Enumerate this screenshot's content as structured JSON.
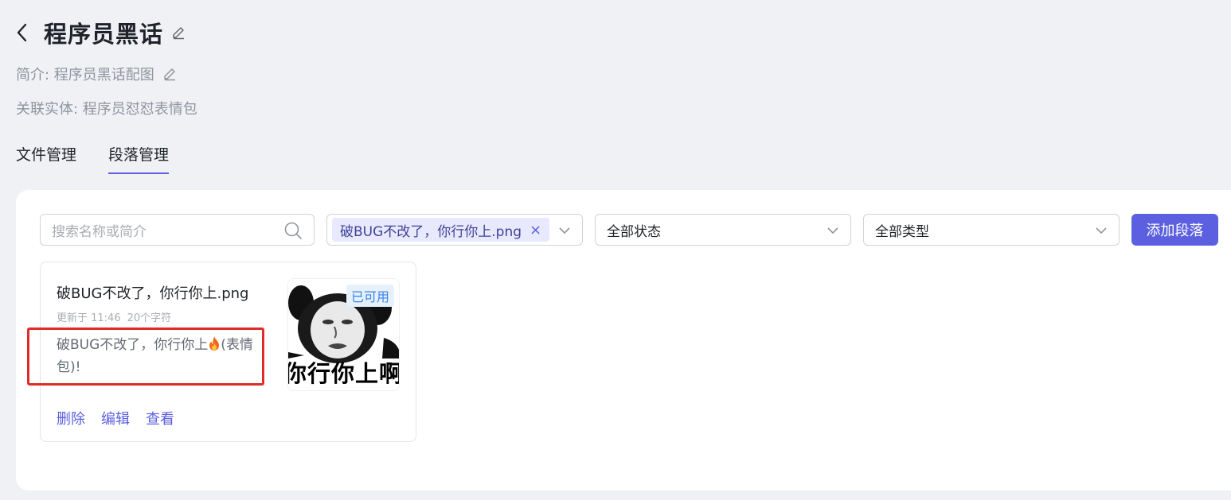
{
  "header": {
    "title": "程序员黑话",
    "intro": "简介: 程序员黑话配图",
    "entity": "关联实体: 程序员怼怼表情包"
  },
  "tabs": [
    {
      "label": "文件管理",
      "active": false
    },
    {
      "label": "段落管理",
      "active": true
    }
  ],
  "toolbar": {
    "search_placeholder": "搜索名称或简介",
    "file_tag": "破BUG不改了，你行你上.png",
    "status_select": "全部状态",
    "type_select": "全部类型",
    "add_button": "添加段落"
  },
  "card": {
    "name": "破BUG不改了，你行你上.png",
    "updated": "更新于 11:46",
    "chars": "20个字符",
    "content_before": "破BUG不改了，你行你上",
    "content_after": "(表情包)!",
    "badge": "已可用",
    "thumb_caption": "你行你上啊",
    "actions": {
      "delete": "删除",
      "edit": "编辑",
      "view": "查看"
    }
  },
  "colors": {
    "accent": "#5b5fe0",
    "highlight": "#e02b2b",
    "badge_bg": "#e6f1fd"
  }
}
